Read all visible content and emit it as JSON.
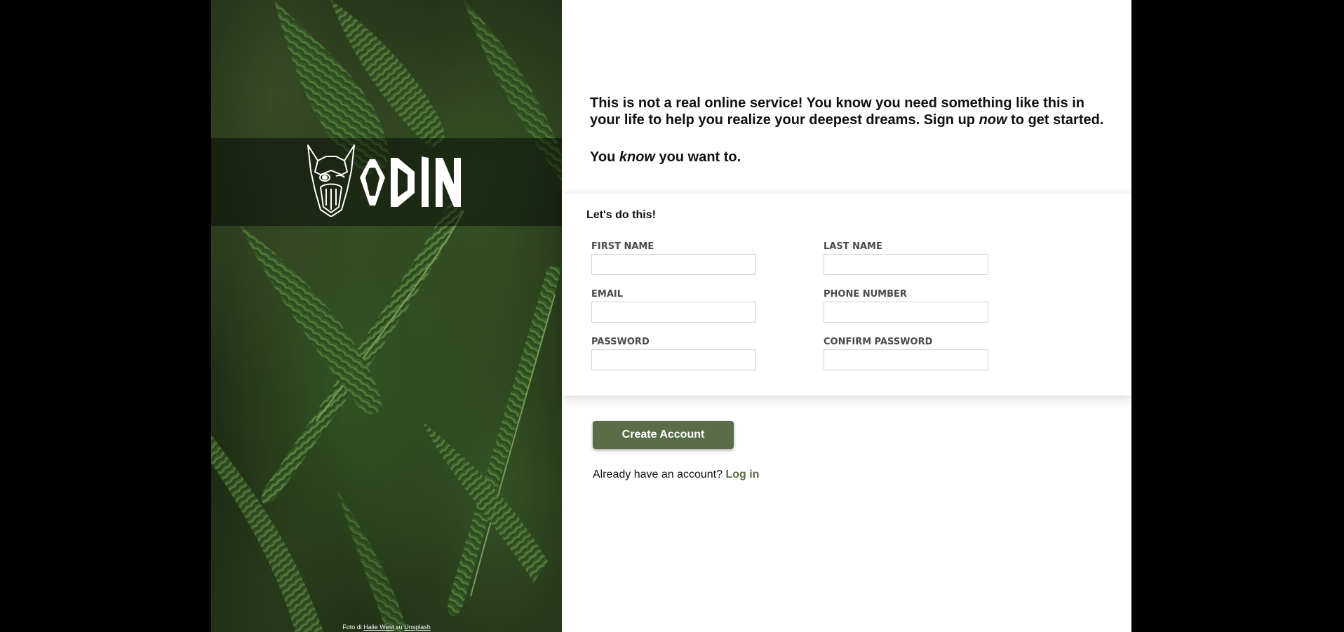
{
  "brand": {
    "logo_text": "ODIN",
    "logo_icon": "viking-head-icon"
  },
  "photo_credit": {
    "prefix": "Foto di",
    "author": "Halie West",
    "middle": "su",
    "site": "Unsplash"
  },
  "intro": {
    "line1_a": "This is not a real online service! You know you need something like this in your life to help you realize your deepest dreams. Sign up ",
    "line1_em": "now",
    "line1_b": " to get started.",
    "line2_a": "You ",
    "line2_em": "know",
    "line2_b": " you want to."
  },
  "form": {
    "title": "Let's do this!",
    "fields": {
      "first_name": "FIRST NAME",
      "last_name": "LAST NAME",
      "email": "EMAIL",
      "phone": "PHONE NUMBER",
      "password": "PASSWORD",
      "confirm_password": "CONFIRM PASSWORD"
    }
  },
  "actions": {
    "create_account": "Create Account",
    "login_prompt": "Already have an account?",
    "login_link": "Log in"
  },
  "colors": {
    "accent": "#596d48",
    "background": "#000000"
  }
}
